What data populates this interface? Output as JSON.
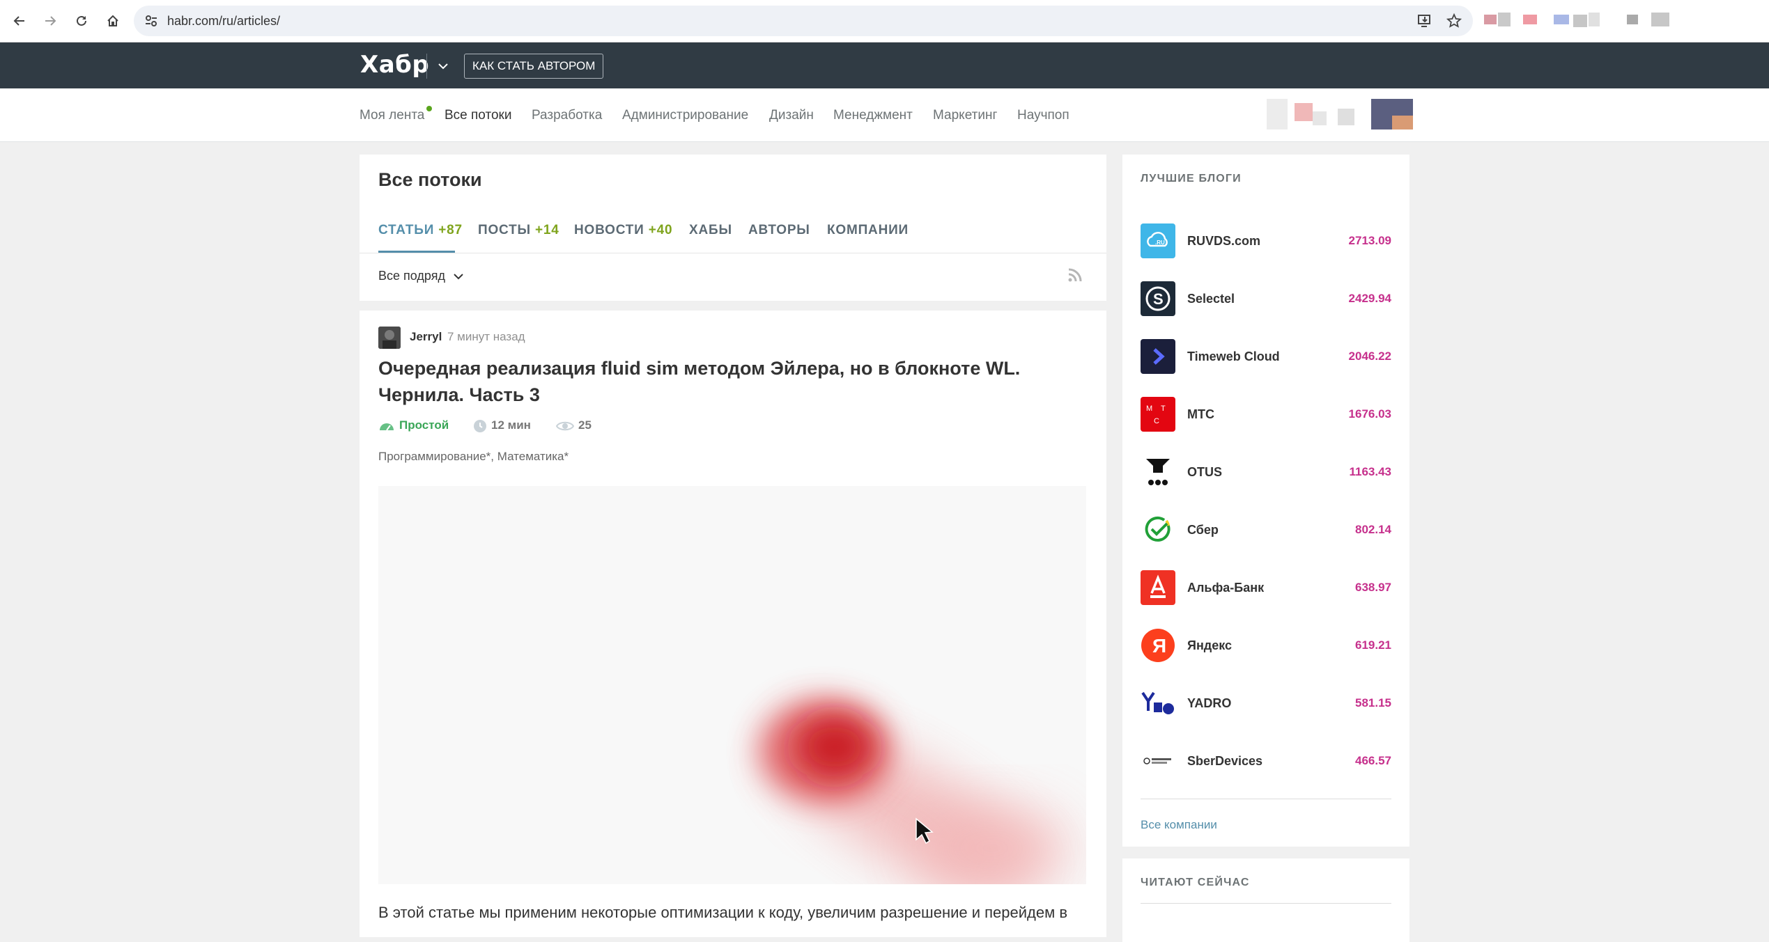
{
  "browser": {
    "url": "habr.com/ru/articles/"
  },
  "header": {
    "logo": "Хабр",
    "author_button": "КАК СТАТЬ АВТОРОМ"
  },
  "subnav": {
    "items": [
      "Моя лента",
      "Все потоки",
      "Разработка",
      "Администрирование",
      "Дизайн",
      "Менеджмент",
      "Маркетинг",
      "Научпоп"
    ],
    "active": "Все потоки"
  },
  "feed": {
    "title": "Все потоки",
    "tabs": [
      {
        "label": "СТАТЬИ",
        "count": "+87"
      },
      {
        "label": "ПОСТЫ",
        "count": "+14"
      },
      {
        "label": "НОВОСТИ",
        "count": "+40"
      },
      {
        "label": "ХАБЫ",
        "count": ""
      },
      {
        "label": "АВТОРЫ",
        "count": ""
      },
      {
        "label": "КОМПАНИИ",
        "count": ""
      }
    ],
    "filter": "Все подряд"
  },
  "article": {
    "author": "Jerryl",
    "time": "7 минут назад",
    "title": "Очередная реализация fluid sim методом Эйлера, но в блокноте WL. Чернила. Часть 3",
    "complexity": "Простой",
    "read_time": "12 мин",
    "views": "25",
    "hubs": "Программирование*, Математика*",
    "lead": "В этой статье мы применим некоторые оптимизации к коду, увеличим разрешение и перейдем в"
  },
  "sidebar": {
    "best_blogs_title": "ЛУЧШИЕ БЛОГИ",
    "blogs": [
      {
        "name": "RUVDS.com",
        "rating": "2713.09",
        "color": "#3fb6e8"
      },
      {
        "name": "Selectel",
        "rating": "2429.94",
        "color": "#1d2a38"
      },
      {
        "name": "Timeweb Cloud",
        "rating": "2046.22",
        "color": "#1b1f3b"
      },
      {
        "name": "МТС",
        "rating": "1676.03",
        "color": "#e30611"
      },
      {
        "name": "OTUS",
        "rating": "1163.43",
        "color": "#ffffff"
      },
      {
        "name": "Сбер",
        "rating": "802.14",
        "color": "#ffffff"
      },
      {
        "name": "Альфа-Банк",
        "rating": "638.97",
        "color": "#ef3124"
      },
      {
        "name": "Яндекс",
        "rating": "619.21",
        "color": "#fc3f1d"
      },
      {
        "name": "YADRO",
        "rating": "581.15",
        "color": "#ffffff"
      },
      {
        "name": "SberDevices",
        "rating": "466.57",
        "color": "#ffffff"
      }
    ],
    "all_companies": "Все компании",
    "reading_now_title": "ЧИТАЮТ СЕЙЧАС"
  }
}
